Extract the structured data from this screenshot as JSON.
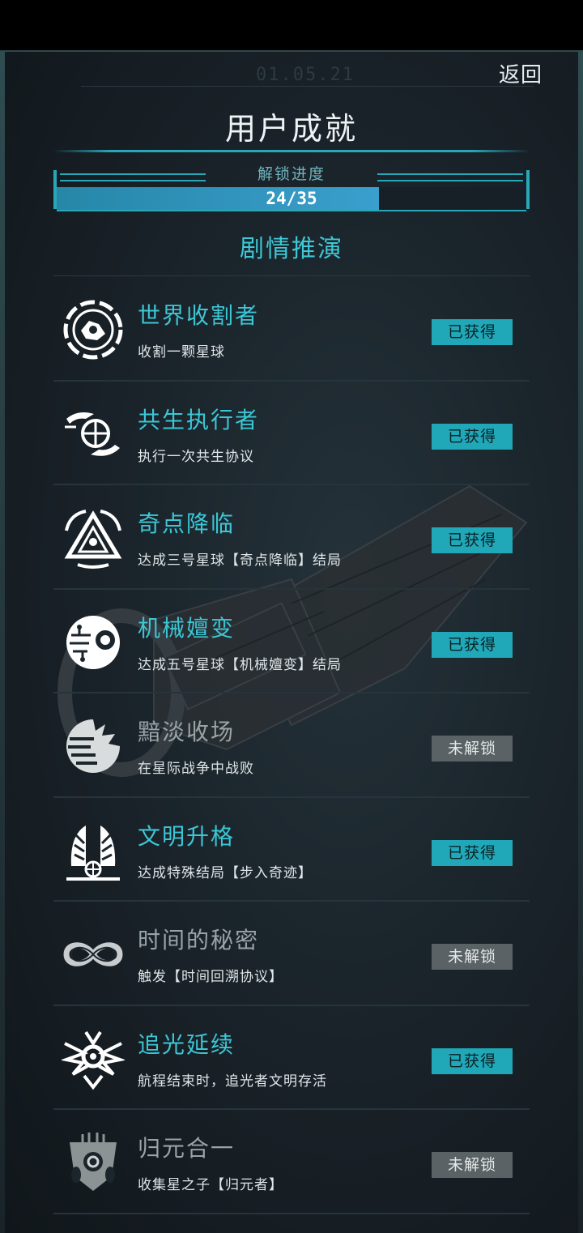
{
  "header": {
    "date": "01.05.21",
    "back_label": "返回",
    "title": "用户成就"
  },
  "progress": {
    "label": "解锁进度",
    "text": "24/35",
    "current": 24,
    "total": 35
  },
  "section": {
    "title": "剧情推演"
  },
  "colors": {
    "accent": "#2aa7b6",
    "unlocked_title": "#3cc7d6",
    "locked_title": "#9aa3a6",
    "unlocked_badge": "#20a8b8",
    "locked_badge": "#5b6265"
  },
  "achievements": [
    {
      "name": "世界收割者",
      "desc": "收割一颗星球",
      "status": "已获得",
      "unlocked": true,
      "icon": "planet-harvest-icon"
    },
    {
      "name": "共生执行者",
      "desc": "执行一次共生协议",
      "status": "已获得",
      "unlocked": true,
      "icon": "globe-hands-icon"
    },
    {
      "name": "奇点降临",
      "desc": "达成三号星球【奇点降临】结局",
      "status": "已获得",
      "unlocked": true,
      "icon": "singularity-triangle-icon"
    },
    {
      "name": "机械嬗变",
      "desc": "达成五号星球【机械嬗变】结局",
      "status": "已获得",
      "unlocked": true,
      "icon": "circuit-eye-icon"
    },
    {
      "name": "黯淡收场",
      "desc": "在星际战争中战败",
      "status": "未解锁",
      "unlocked": false,
      "icon": "shattered-planet-icon"
    },
    {
      "name": "文明升格",
      "desc": "达成特殊结局【步入奇迹】",
      "status": "已获得",
      "unlocked": true,
      "icon": "winged-globe-icon"
    },
    {
      "name": "时间的秘密",
      "desc": "触发【时间回溯协议】",
      "status": "未解锁",
      "unlocked": false,
      "icon": "infinity-icon"
    },
    {
      "name": "追光延续",
      "desc": "航程结束时，追光者文明存活",
      "status": "已获得",
      "unlocked": true,
      "icon": "radiant-emblem-icon"
    },
    {
      "name": "归元合一",
      "desc": "收集星之子【归元者】",
      "status": "未解锁",
      "unlocked": false,
      "icon": "mask-core-icon"
    }
  ]
}
